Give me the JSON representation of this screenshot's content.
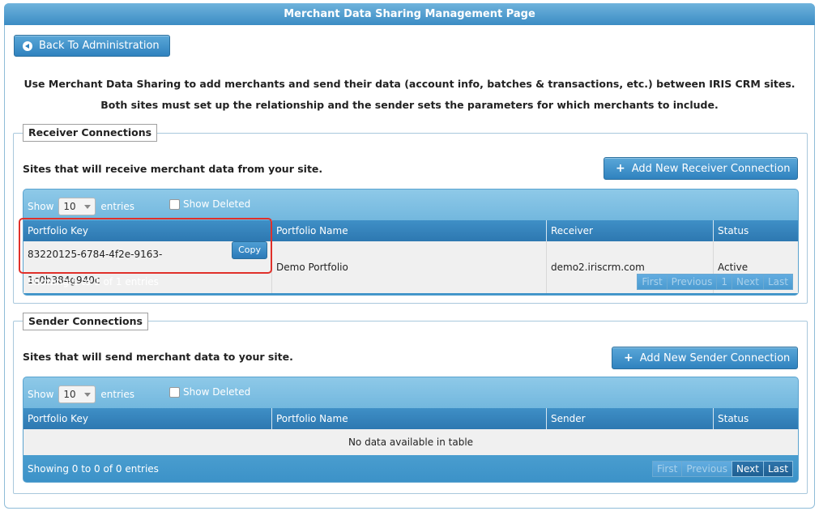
{
  "header": {
    "title": "Merchant Data Sharing Management Page"
  },
  "back_button": {
    "label": "Back To Administration"
  },
  "intro": {
    "line1": "Use Merchant Data Sharing to add merchants and send their data (account info, batches & transactions, etc.) between IRIS CRM sites.",
    "line2": "Both sites must set up the relationship and the sender sets the parameters for which merchants to include."
  },
  "receiver": {
    "legend": "Receiver Connections",
    "description": "Sites that will receive merchant data from your site.",
    "add_button": "Add New Receiver Connection",
    "show_label": "Show",
    "entries_value": "10",
    "entries_label": "entries",
    "show_deleted": "Show Deleted",
    "columns": [
      "Portfolio Key",
      "Portfolio Name",
      "Receiver",
      "Status"
    ],
    "rows": [
      {
        "portfolio_key": "83220125-6784-4f2e-9163-1c0b384g940c",
        "copy_label": "Copy",
        "portfolio_name": "Demo Portfolio",
        "receiver": "demo2.iriscrm.com",
        "status": "Active"
      }
    ],
    "info": "Showing 1 to 1 of 1 entries",
    "pager": {
      "first": "First",
      "previous": "Previous",
      "page": "1",
      "next": "Next",
      "last": "Last"
    }
  },
  "sender": {
    "legend": "Sender Connections",
    "description": "Sites that will send merchant data to your site.",
    "add_button": "Add New Sender Connection",
    "show_label": "Show",
    "entries_value": "10",
    "entries_label": "entries",
    "show_deleted": "Show Deleted",
    "columns": [
      "Portfolio Key",
      "Portfolio Name",
      "Sender",
      "Status"
    ],
    "empty_message": "No data available in table",
    "info": "Showing 0 to 0 of 0 entries",
    "pager": {
      "first": "First",
      "previous": "Previous",
      "next": "Next",
      "last": "Last"
    }
  },
  "colors": {
    "header_blue": "#3b8cc4",
    "highlight_red": "#e0302a"
  }
}
